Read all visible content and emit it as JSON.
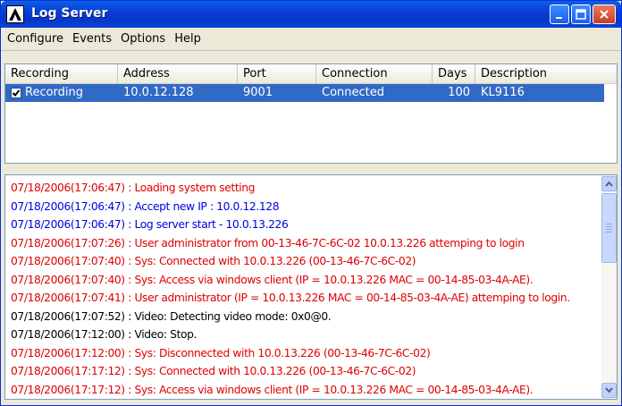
{
  "window": {
    "title": "Log Server"
  },
  "titlebar": {
    "buttons": [
      "minimize",
      "maximize",
      "close"
    ]
  },
  "menu": [
    "Configure",
    "Events",
    "Options",
    "Help"
  ],
  "list": {
    "columns": [
      "Recording",
      "Address",
      "Port",
      "Connection",
      "Days",
      "Description"
    ],
    "rows": [
      {
        "recording": "Recording",
        "checked": true,
        "address": "10.0.12.128",
        "port": "9001",
        "connection": "Connected",
        "days": "100",
        "description": "KL9116"
      }
    ]
  },
  "log": {
    "lines": [
      {
        "text": "07/18/2006(17:06:47) : Loading system setting",
        "color": "#e00000"
      },
      {
        "text": "07/18/2006(17:06:47) : Accept new IP : 10.0.12.128",
        "color": "#0000e0"
      },
      {
        "text": "07/18/2006(17:06:47) : Log server start - 10.0.13.226",
        "color": "#0000e0"
      },
      {
        "text": "07/18/2006(17:07:26) : User administrator from 00-13-46-7C-6C-02 10.0.13.226 attemping to login",
        "color": "#e00000"
      },
      {
        "text": "07/18/2006(17:07:40) : Sys: Connected with 10.0.13.226 (00-13-46-7C-6C-02)",
        "color": "#e00000"
      },
      {
        "text": "07/18/2006(17:07:40) : Sys: Access via windows client (IP = 10.0.13.226 MAC = 00-14-85-03-4A-AE).",
        "color": "#e00000"
      },
      {
        "text": "07/18/2006(17:07:41) : User administrator (IP = 10.0.13.226 MAC = 00-14-85-03-4A-AE) attemping to login.",
        "color": "#e00000"
      },
      {
        "text": "07/18/2006(17:07:52) : Video: Detecting video mode: 0x0@0.",
        "color": "#000000"
      },
      {
        "text": "07/18/2006(17:12:00) : Video: Stop.",
        "color": "#000000"
      },
      {
        "text": "07/18/2006(17:12:00) : Sys: Disconnected with 10.0.13.226 (00-13-46-7C-6C-02)",
        "color": "#e00000"
      },
      {
        "text": "07/18/2006(17:17:12) : Sys: Connected with 10.0.13.226 (00-13-46-7C-6C-02)",
        "color": "#e00000"
      },
      {
        "text": "07/18/2006(17:17:12) : Sys: Access via windows client (IP = 10.0.13.226 MAC = 00-14-85-03-4A-AE).",
        "color": "#e00000"
      }
    ]
  },
  "colors": {
    "selection": "#316ac5",
    "titlebar": "#0a3fd6",
    "error": "#e00000",
    "info": "#0000e0"
  }
}
